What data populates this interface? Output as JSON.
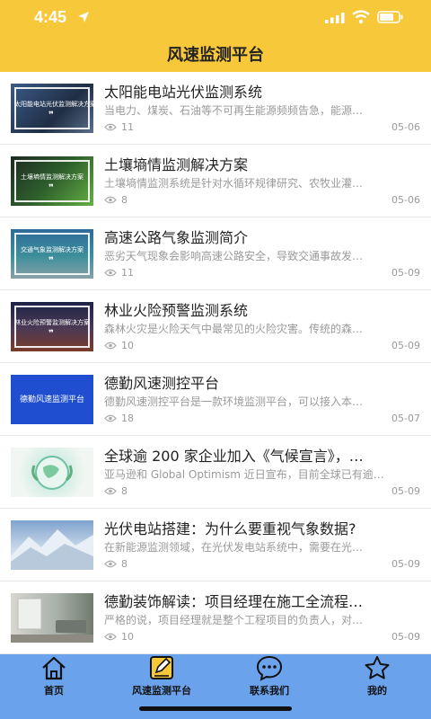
{
  "status_bar": {
    "time": "4:45"
  },
  "header": {
    "title": "风速监测平台"
  },
  "articles": [
    {
      "title": "太阳能电站光伏监测系统",
      "desc": "当电力、煤炭、石油等不可再生能源频频告急，能源…",
      "views": "11",
      "date": "05-06",
      "thumb_caption": "太阳能电站光伏监测解决方案"
    },
    {
      "title": "土壤墒情监测解决方案",
      "desc": "土壤墒情监测系统是针对水循环规律研究、农牧业灌…",
      "views": "8",
      "date": "05-06",
      "thumb_caption": "土壤墒情监测解决方案"
    },
    {
      "title": "高速公路气象监测简介",
      "desc": "恶劣天气现象会影响高速公路安全，导致交通事故发…",
      "views": "11",
      "date": "05-09",
      "thumb_caption": "交通气象监测解决方案"
    },
    {
      "title": "林业火险预警监测系统",
      "desc": "森林火灾是火险天气中最常见的火险灾害。传统的森…",
      "views": "10",
      "date": "05-09",
      "thumb_caption": "林业火险预警监测解决方案"
    },
    {
      "title": "德勤风速测控平台",
      "desc": "德勤风速测控平台是一款环境监测平台，可以接入本…",
      "views": "18",
      "date": "05-07",
      "thumb_caption": "德勤风速监测平台"
    },
    {
      "title": "全球逾 200 家企业加入《气候宣言》，…",
      "desc": "亚马逊和 Global Optimism 近日宣布，目前全球已有逾…",
      "views": "8",
      "date": "05-09",
      "thumb_caption": ""
    },
    {
      "title": "光伏电站搭建：为什么要重视气象数据?",
      "desc": "在新能源监测领域，在光伏发电站系统中，需要在光…",
      "views": "8",
      "date": "05-09",
      "thumb_caption": ""
    },
    {
      "title": "德勤装饰解读：项目经理在施工全流程…",
      "desc": "严格的说，项目经理就是整个工程项目的负责人，对…",
      "views": "10",
      "date": "05-09",
      "thumb_caption": ""
    }
  ],
  "tabs": [
    {
      "label": "首页",
      "icon": "home-icon"
    },
    {
      "label": "风速监测平台",
      "icon": "edit-icon"
    },
    {
      "label": "联系我们",
      "icon": "chat-icon"
    },
    {
      "label": "我的",
      "icon": "star-icon"
    }
  ],
  "colors": {
    "header": "#f7c83a",
    "tabbar": "#6aa2ec",
    "edit_icon": "#f7c83a"
  }
}
